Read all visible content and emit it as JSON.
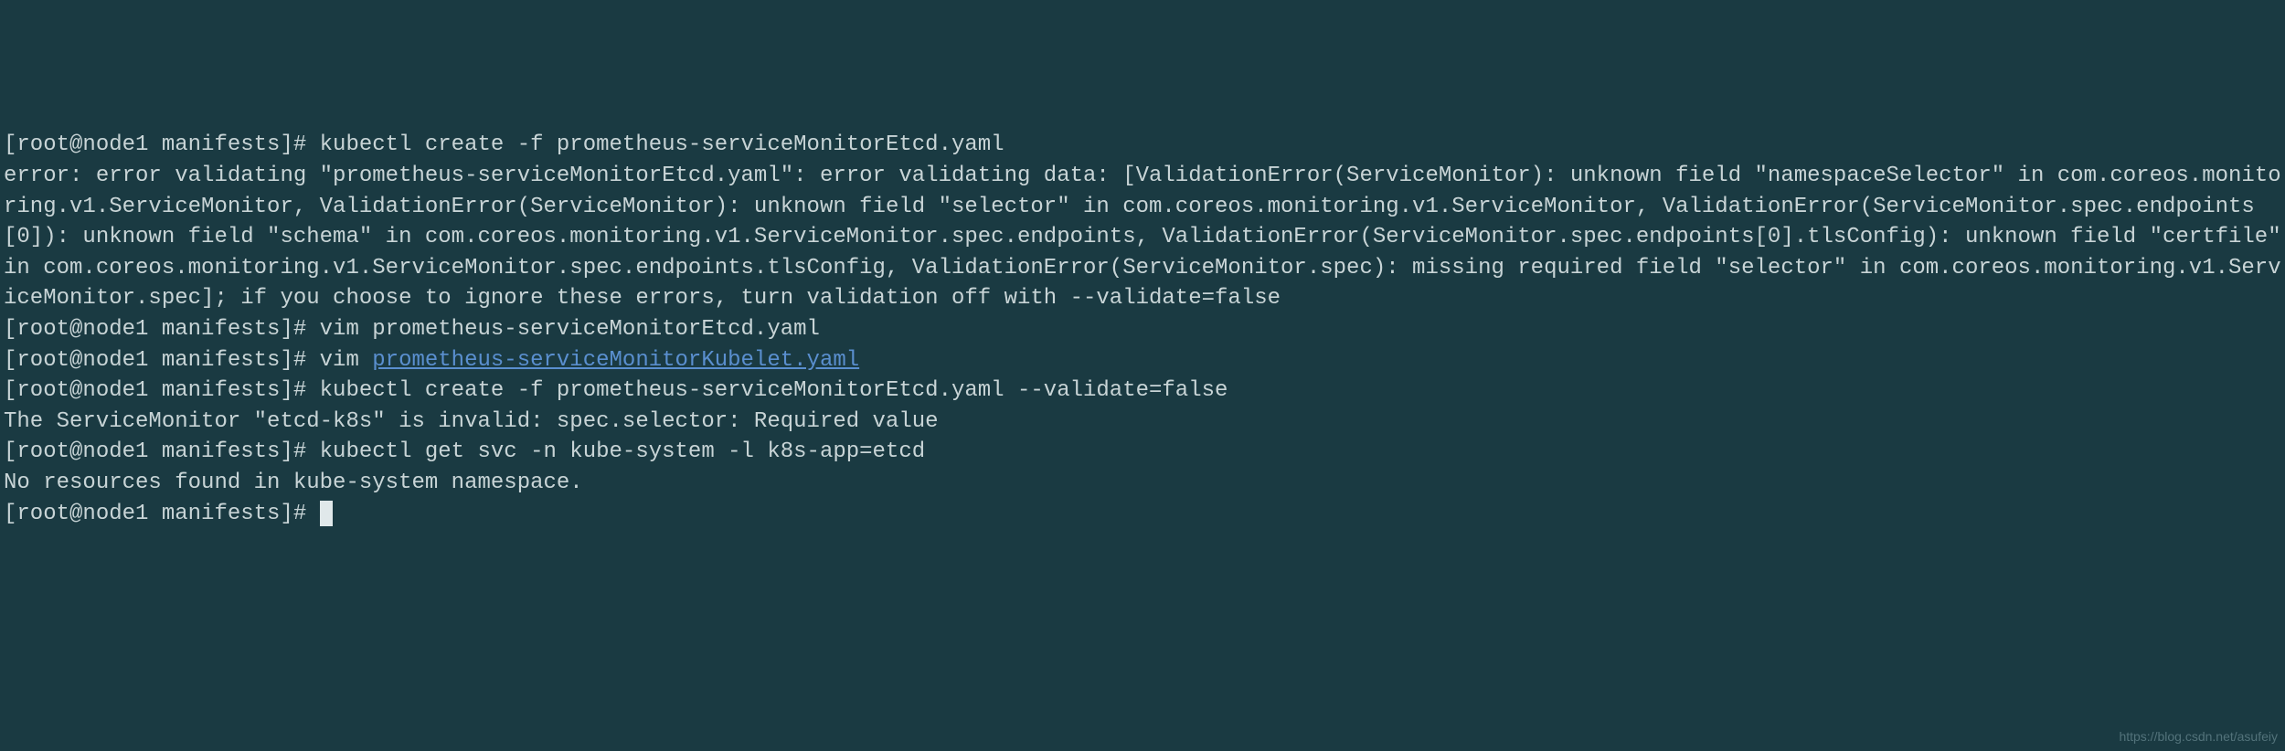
{
  "lines": {
    "l1_prompt": "[root@node1 manifests]# ",
    "l1_cmd": "kubectl create -f prometheus-serviceMonitorEtcd.yaml",
    "l2_error": "error: error validating \"prometheus-serviceMonitorEtcd.yaml\": error validating data: [ValidationError(ServiceMonitor): unknown field \"namespaceSelector\" in com.coreos.monitoring.v1.ServiceMonitor, ValidationError(ServiceMonitor): unknown field \"selector\" in com.coreos.monitoring.v1.ServiceMonitor, ValidationError(ServiceMonitor.spec.endpoints[0]): unknown field \"schema\" in com.coreos.monitoring.v1.ServiceMonitor.spec.endpoints, ValidationError(ServiceMonitor.spec.endpoints[0].tlsConfig): unknown field \"certfile\" in com.coreos.monitoring.v1.ServiceMonitor.spec.endpoints.tlsConfig, ValidationError(ServiceMonitor.spec): missing required field \"selector\" in com.coreos.monitoring.v1.ServiceMonitor.spec]; if you choose to ignore these errors, turn validation off with --validate=false",
    "l3_prompt": "[root@node1 manifests]# ",
    "l3_cmd": "vim prometheus-serviceMonitorEtcd.yaml",
    "l4_prompt": "[root@node1 manifests]# ",
    "l4_cmd_prefix": "vim ",
    "l4_link": "prometheus-serviceMonitorKubelet.yaml",
    "l5_prompt": "[root@node1 manifests]# ",
    "l5_cmd": "kubectl create -f prometheus-serviceMonitorEtcd.yaml --validate=false",
    "l6_out": "The ServiceMonitor \"etcd-k8s\" is invalid: spec.selector: Required value",
    "l7_prompt": "[root@node1 manifests]# ",
    "l7_cmd": "kubectl get svc -n kube-system -l k8s-app=etcd",
    "l8_out": "No resources found in kube-system namespace.",
    "l9_prompt": "[root@node1 manifests]# "
  },
  "watermark": "https://blog.csdn.net/asufeiy"
}
